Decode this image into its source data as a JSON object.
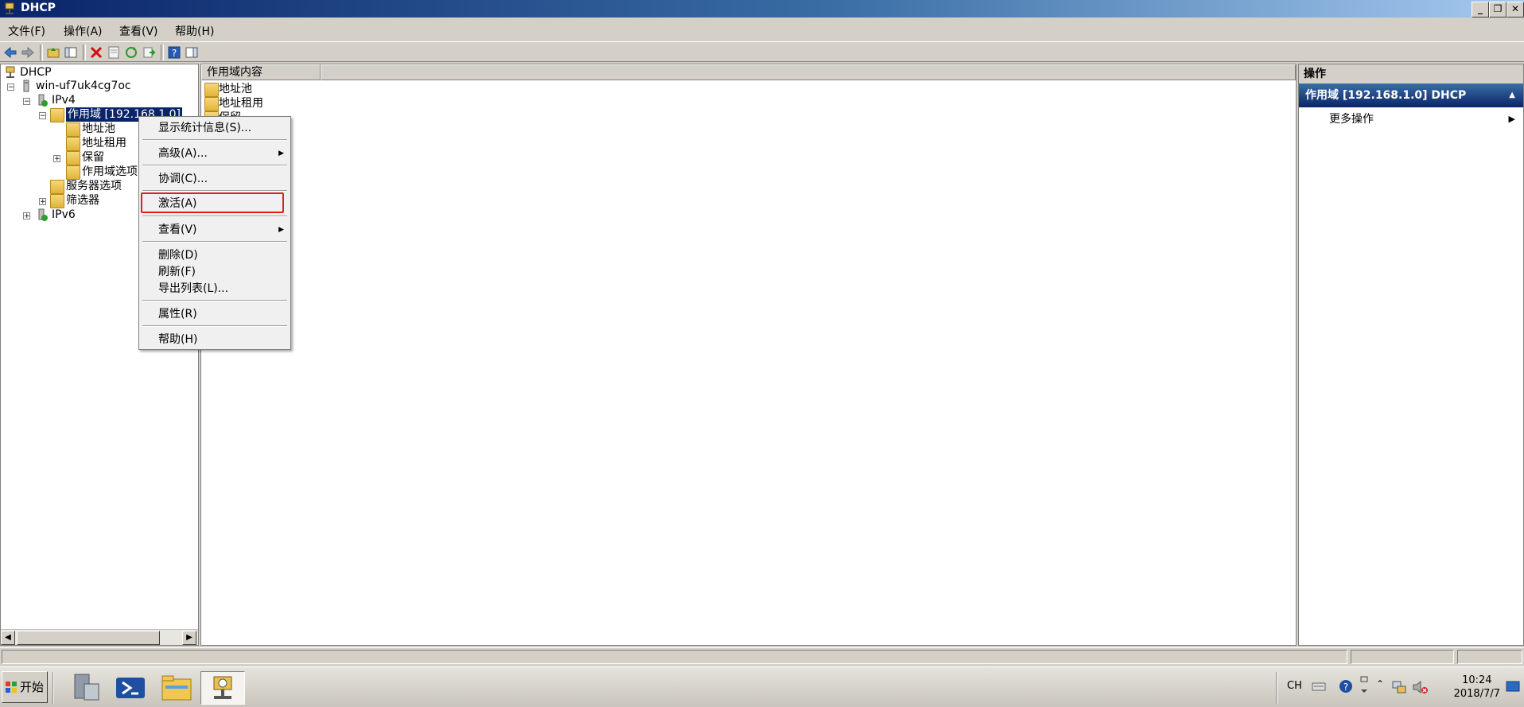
{
  "window": {
    "title": "DHCP"
  },
  "menu": [
    "文件(F)",
    "操作(A)",
    "查看(V)",
    "帮助(H)"
  ],
  "tree": {
    "root": "DHCP",
    "server": "win-uf7uk4cg7oc",
    "ipv4": "IPv4",
    "scope": "作用域 [192.168.1.0]",
    "address_pool": "地址池",
    "address_leases": "地址租用",
    "reservations": "保留",
    "scope_options": "作用域选项",
    "server_options": "服务器选项",
    "filters": "筛选器",
    "ipv6": "IPv6"
  },
  "content": {
    "column_header": "作用域内容",
    "items": [
      "地址池",
      "地址租用",
      "保留"
    ]
  },
  "actions": {
    "header": "操作",
    "section": "作用域 [192.168.1.0] DHCP",
    "more": "更多操作"
  },
  "context_menu": {
    "items": [
      "显示统计信息(S)...",
      "高级(A)...",
      "协调(C)...",
      "激活(A)",
      "查看(V)",
      "删除(D)",
      "刷新(F)",
      "导出列表(L)...",
      "属性(R)",
      "帮助(H)"
    ]
  },
  "taskbar": {
    "start": "开始",
    "lang": "CH",
    "time": "10:24",
    "date": "2018/7/7"
  },
  "colors": {
    "selection": "#0a246a",
    "highlight_box": "#e02020"
  }
}
